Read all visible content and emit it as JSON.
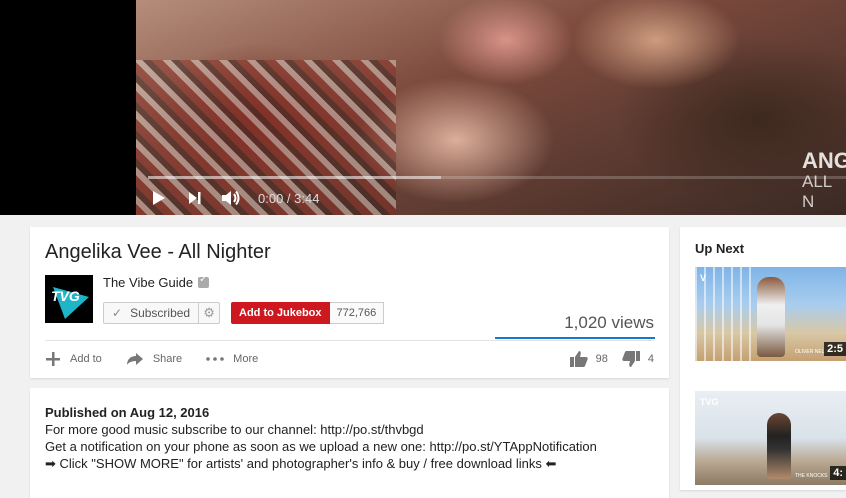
{
  "player": {
    "overlay_line1": "ANG",
    "overlay_line2": "ALL N",
    "time": "0:00 / 3:44",
    "buffered_fraction": 0.42,
    "icons": [
      "play-icon",
      "next-icon",
      "volume-icon"
    ]
  },
  "video": {
    "title": "Angelika Vee - All Nighter",
    "channel": "The Vibe Guide",
    "avatar_text": "TVG",
    "subscribed_label": "Subscribed",
    "jukebox_label": "Add to Jukebox",
    "jukebox_count": "772,766",
    "views": "1,020 views",
    "like_fraction": 0.96,
    "actions": {
      "add_to": "Add to",
      "share": "Share",
      "more": "More"
    },
    "likes": "98",
    "dislikes": "4"
  },
  "description": {
    "published": "Published on Aug 12, 2016",
    "lines": [
      "For more good music subscribe to our channel: http://po.st/thvbgd",
      "Get a notification on your phone as soon as we upload a new one: http://po.st/YTAppNotification",
      "➡ Click \"SHOW MORE\" for artists' and photographer's info & buy / free download links ⬅"
    ]
  },
  "up_next": {
    "header": "Up Next",
    "items": [
      {
        "logo": "V",
        "caption": "OLIVER NELS",
        "duration": "2:5"
      },
      {
        "logo": "TVG",
        "caption": "THE KNOCKS",
        "duration": "4:"
      }
    ]
  },
  "colors": {
    "accent_red": "#cc181e",
    "sentiment_blue": "#167ac6",
    "avatar_teal": "#1fb5c9"
  }
}
